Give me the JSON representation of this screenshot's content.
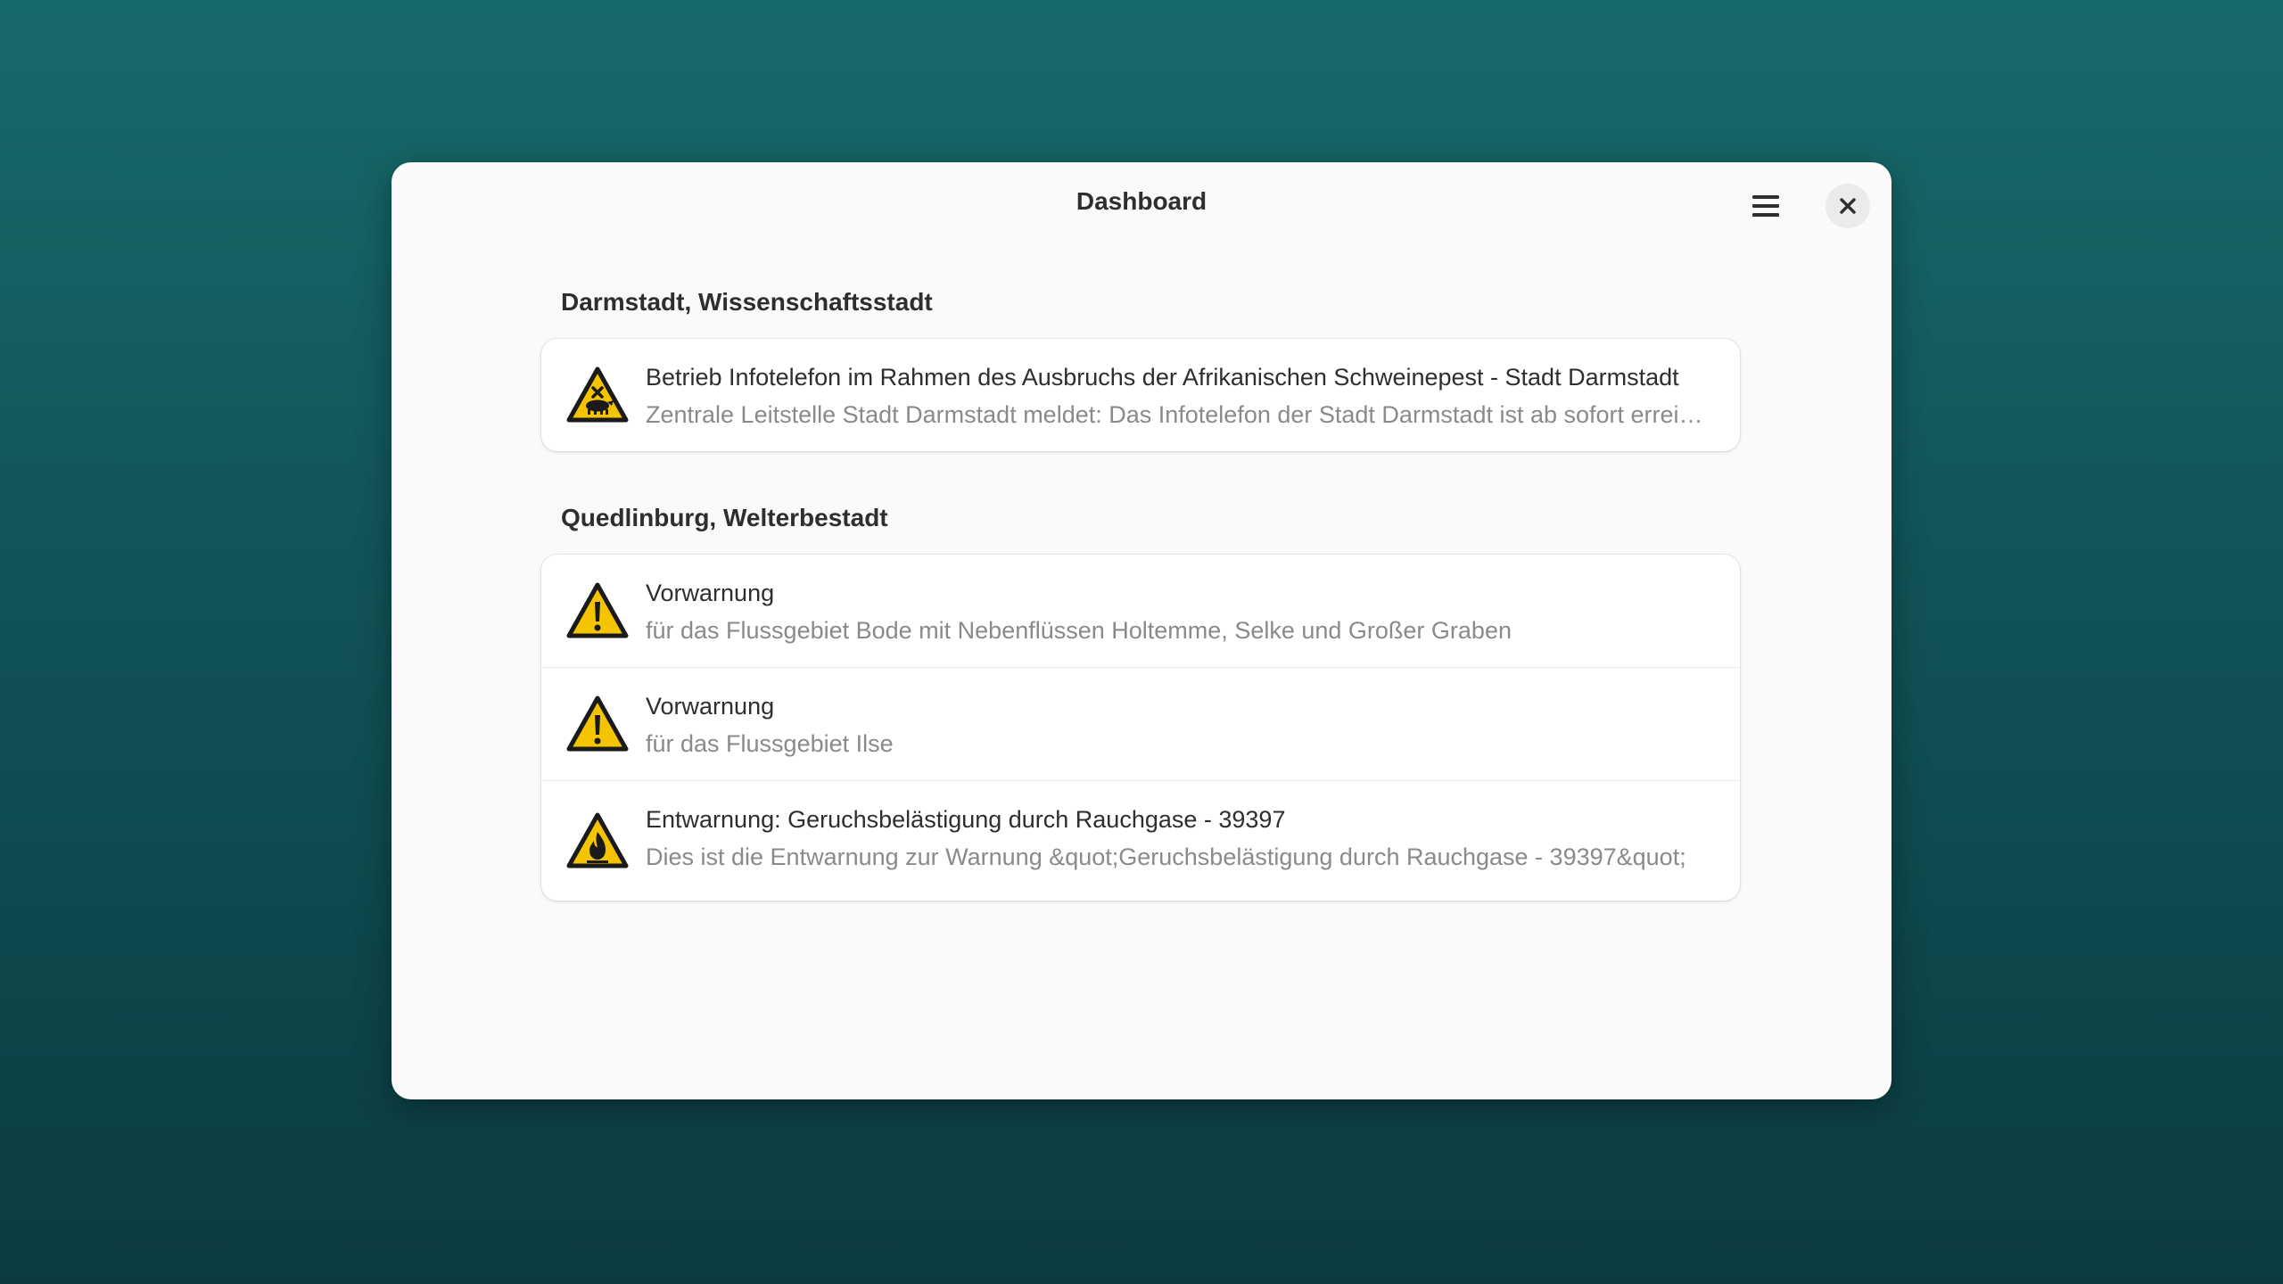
{
  "window": {
    "title": "Dashboard"
  },
  "icons": {
    "menu": "hamburger-menu-icon",
    "close": "close-icon",
    "animal_disease": "animal-disease-warning-icon",
    "warning": "exclamation-warning-icon",
    "fire": "fire-warning-icon"
  },
  "colors": {
    "warning_yellow": "#f5c400",
    "background_top": "#176a6b",
    "background_bottom": "#0b3b40"
  },
  "groups": [
    {
      "title": "Darmstadt, Wissenschaftsstadt",
      "items": [
        {
          "icon": "animal-disease-warning-icon",
          "title": "Betrieb Infotelefon im Rahmen des Ausbruchs der Afrikanischen Schweinepest - Stadt Darmstadt",
          "subtitle": "Zentrale Leitstelle Stadt Darmstadt meldet: Das Infotelefon der Stadt Darmstadt ist ab sofort erreichbar"
        }
      ]
    },
    {
      "title": "Quedlinburg, Welterbestadt",
      "items": [
        {
          "icon": "exclamation-warning-icon",
          "title": "Vorwarnung",
          "subtitle": "für das Flussgebiet Bode mit Nebenflüssen Holtemme, Selke und Großer Graben"
        },
        {
          "icon": "exclamation-warning-icon",
          "title": "Vorwarnung",
          "subtitle": "für das Flussgebiet Ilse"
        },
        {
          "icon": "fire-warning-icon",
          "title": "Entwarnung: Geruchsbelästigung durch Rauchgase - 39397",
          "subtitle": "Dies ist die Entwarnung zur Warnung &quot;Geruchsbelästigung durch Rauchgase - 39397&quot;"
        }
      ]
    }
  ]
}
